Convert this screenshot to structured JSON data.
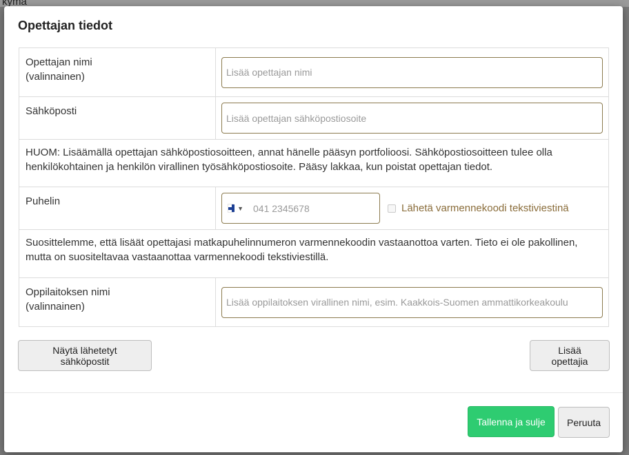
{
  "background": {
    "peek_text": "kymä"
  },
  "modal": {
    "title": "Opettajan tiedot",
    "teacher_name": {
      "label": "Opettajan nimi",
      "label_sub": "(valinnainen)",
      "placeholder": "Lisää opettajan nimi",
      "value": ""
    },
    "email": {
      "label": "Sähköposti",
      "placeholder": "Lisää opettajan sähköpostiosoite",
      "value": ""
    },
    "email_note": "HUOM: Lisäämällä opettajan sähköpostiosoitteen, annat hänelle pääsyn portfolioosi. Sähköpostiosoitteen tulee olla henkilökohtainen ja henkilön virallinen työsähköpostiosoite. Pääsy lakkaa, kun poistat opettajan tiedot.",
    "phone": {
      "label": "Puhelin",
      "country_flag": "finland-flag-icon",
      "placeholder": "041 2345678",
      "value": "",
      "sms_label": "Lähetä varmennekoodi tekstiviestinä",
      "sms_checked": false
    },
    "phone_note": "Suosittelemme, että lisäät opettajasi matkapuhelinnumeron varmennekoodin vastaanottoa varten. Tieto ei ole pakollinen, mutta on suositeltavaa vastaanottaa varmennekoodi tekstiviestillä.",
    "school": {
      "label": "Oppilaitoksen nimi",
      "label_sub": "(valinnainen)",
      "placeholder": "Lisää oppilaitoksen virallinen nimi, esim. Kaakkois-Suomen ammattikorkeakoulu",
      "value": ""
    },
    "buttons": {
      "show_sent": "Näytä lähetetyt sähköpostit",
      "add_teachers": "Lisää opettajia",
      "save_close": "Tallenna ja sulje",
      "cancel": "Peruuta"
    },
    "colors": {
      "primary_save": "#2ecc71",
      "input_border": "#8b7a4e",
      "sms_label": "#8a6d3b"
    }
  }
}
